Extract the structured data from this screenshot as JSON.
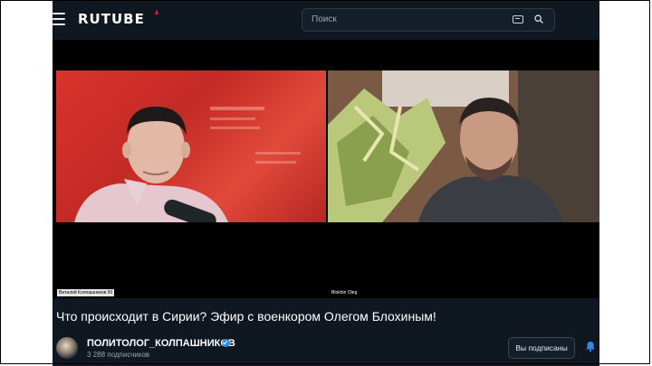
{
  "header": {
    "logo_text": "RUTUBE",
    "search_placeholder": "Поиск"
  },
  "video": {
    "participants": [
      {
        "caption": "Виталий Колпашников 90"
      },
      {
        "caption": "Blokhin Oleg"
      }
    ]
  },
  "title": "Что происходит в Сирии? Эфир с военкором Олегом Блохиным!",
  "channel": {
    "name": "ПОЛИТОЛОГ_КОЛПАШНИКОВ",
    "subscribers": "3 288 подписчиков",
    "subscribe_label": "Вы подписаны"
  },
  "colors": {
    "background": "#0f1720",
    "logo_accent": "#ed143b",
    "verified": "#2b8cf0",
    "bell": "#2b8cf0"
  }
}
